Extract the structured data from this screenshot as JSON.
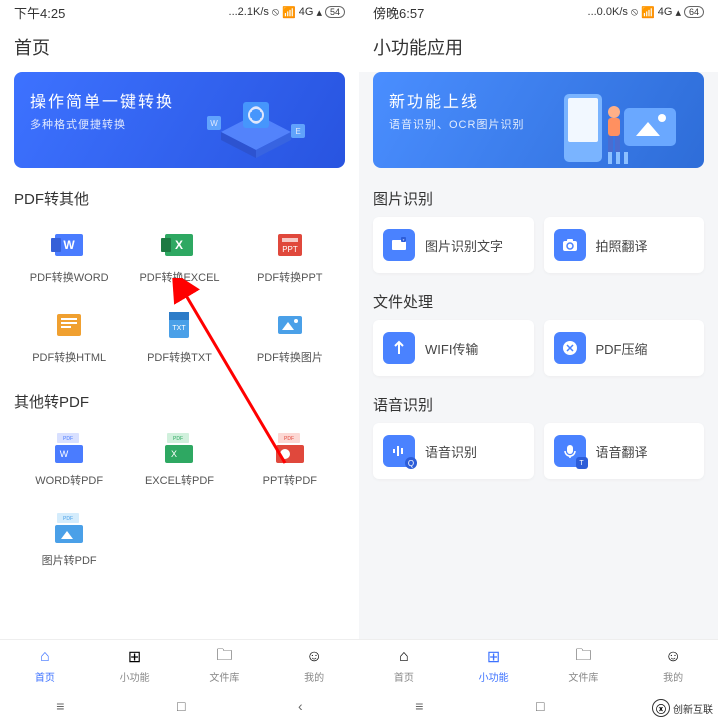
{
  "left": {
    "status": {
      "time": "下午4:25",
      "net": "...2.1K/s",
      "sig": "4G",
      "bat": "54"
    },
    "title": "首页",
    "banner": {
      "title": "操作简单一键转换",
      "sub": "多种格式便捷转换"
    },
    "sec1": {
      "title": "PDF转其他",
      "items": [
        {
          "label": "PDF转换WORD",
          "color": "#4a7cff",
          "mark": "W"
        },
        {
          "label": "PDF转换EXCEL",
          "color": "#2ea862",
          "mark": "X"
        },
        {
          "label": "PDF转换PPT",
          "color": "#e0483c",
          "mark": "P"
        },
        {
          "label": "PDF转换HTML",
          "color": "#f0a030",
          "mark": "H"
        },
        {
          "label": "PDF转换TXT",
          "color": "#4aa0e8",
          "mark": "TXT"
        },
        {
          "label": "PDF转换图片",
          "color": "#4aa0e8",
          "mark": "▭"
        }
      ]
    },
    "sec2": {
      "title": "其他转PDF",
      "items": [
        {
          "label": "WORD转PDF",
          "color": "#4a7cff"
        },
        {
          "label": "EXCEL转PDF",
          "color": "#2ea862"
        },
        {
          "label": "PPT转PDF",
          "color": "#e0483c"
        },
        {
          "label": "图片转PDF",
          "color": "#4aa0e8"
        }
      ]
    },
    "tabs": [
      {
        "label": "首页",
        "active": true
      },
      {
        "label": "小功能",
        "active": false
      },
      {
        "label": "文件库",
        "active": false
      },
      {
        "label": "我的",
        "active": false
      }
    ]
  },
  "right": {
    "status": {
      "time": "傍晚6:57",
      "net": "...0.0K/s",
      "sig": "4G",
      "bat": "64"
    },
    "title": "小功能应用",
    "banner": {
      "title": "新功能上线",
      "sub": "语音识别、OCR图片识别"
    },
    "sec1": {
      "title": "图片识别",
      "items": [
        {
          "label": "图片识别文字",
          "bg": "#4a82ff"
        },
        {
          "label": "拍照翻译",
          "bg": "#4a82ff"
        }
      ]
    },
    "sec2": {
      "title": "文件处理",
      "items": [
        {
          "label": "WIFI传输",
          "bg": "#4a82ff"
        },
        {
          "label": "PDF压缩",
          "bg": "#4a82ff"
        }
      ]
    },
    "sec3": {
      "title": "语音识别",
      "items": [
        {
          "label": "语音识别",
          "bg": "#4a82ff"
        },
        {
          "label": "语音翻译",
          "bg": "#4a82ff"
        }
      ]
    },
    "tabs": [
      {
        "label": "首页",
        "active": false
      },
      {
        "label": "小功能",
        "active": true
      },
      {
        "label": "文件库",
        "active": false
      },
      {
        "label": "我的",
        "active": false
      }
    ]
  },
  "watermark": "创新互联"
}
